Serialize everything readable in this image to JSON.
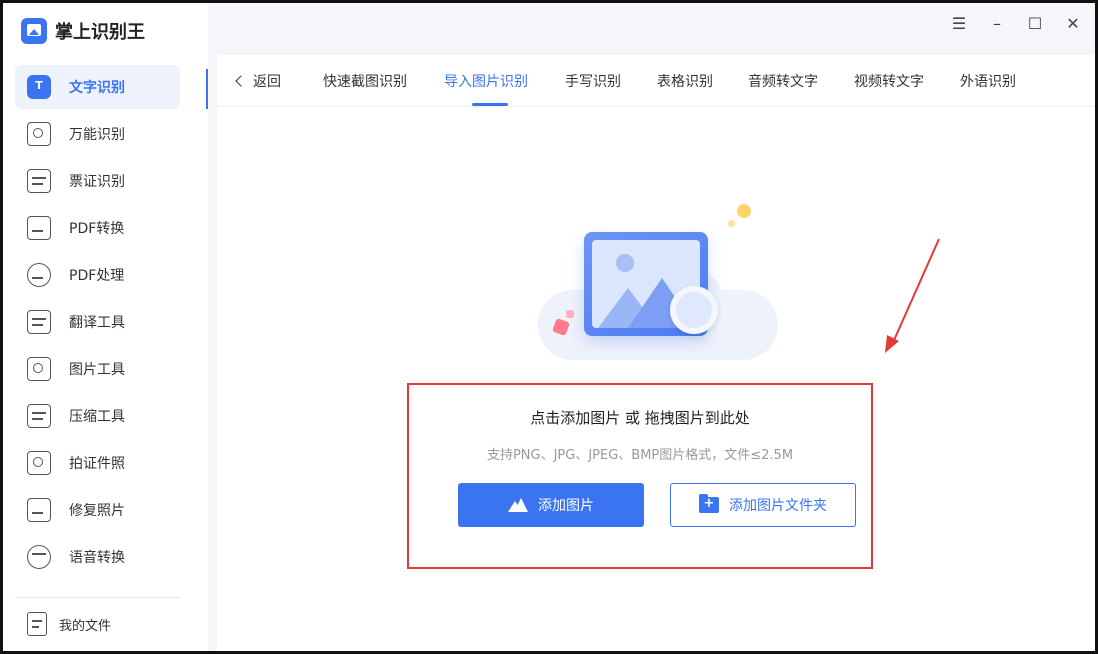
{
  "app": {
    "name": "掌上识别王",
    "logo_icon": "app-logo-icon"
  },
  "window_controls": [
    "menu-icon",
    "minimize-icon",
    "maximize-icon",
    "close-icon"
  ],
  "sidebar": {
    "items": [
      {
        "label": "文字识别",
        "icon": "text-recognition-icon",
        "active": true
      },
      {
        "label": "万能识别",
        "icon": "universal-scan-icon"
      },
      {
        "label": "票证识别",
        "icon": "ticket-icon"
      },
      {
        "label": "PDF转换",
        "icon": "pdf-convert-icon"
      },
      {
        "label": "PDF处理",
        "icon": "pdf-process-icon"
      },
      {
        "label": "翻译工具",
        "icon": "translate-icon"
      },
      {
        "label": "图片工具",
        "icon": "image-tool-icon"
      },
      {
        "label": "压缩工具",
        "icon": "compress-icon"
      },
      {
        "label": "拍证件照",
        "icon": "id-photo-icon"
      },
      {
        "label": "修复照片",
        "icon": "photo-repair-icon"
      },
      {
        "label": "语音转换",
        "icon": "voice-icon"
      }
    ],
    "my_files": "我的文件"
  },
  "toolbar": {
    "back_label": "返回",
    "tabs": [
      "快速截图识别",
      "导入图片识别",
      "手写识别",
      "表格识别",
      "音频转文字",
      "视频转文字",
      "外语识别"
    ],
    "active_tab": "导入图片识别"
  },
  "upload": {
    "title": "点击添加图片 或 拖拽图片到此处",
    "subtitle": "支持PNG、JPG、JPEG、BMP图片格式，文件≤2.5M",
    "add_image": "添加图片",
    "add_folder": "添加图片文件夹"
  },
  "colors": {
    "accent": "#3b74f0",
    "highlight_border": "#e53935",
    "arrow": "#e53935"
  }
}
